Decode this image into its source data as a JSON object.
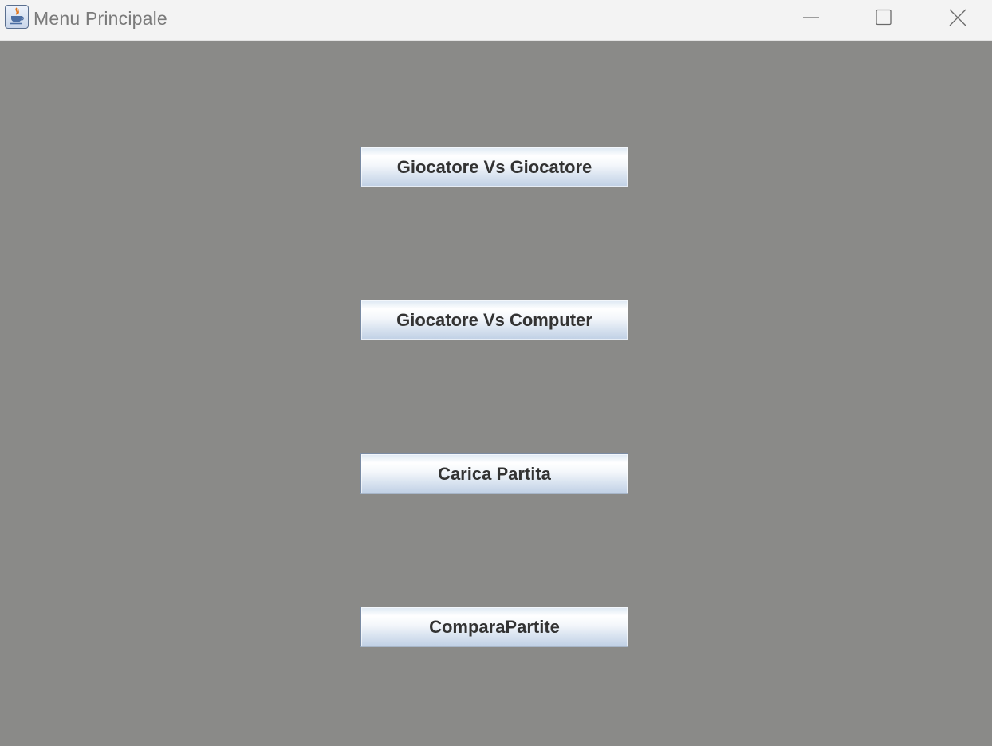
{
  "window": {
    "title": "Menu Principale",
    "app_icon": "java-coffee-cup-icon",
    "controls": {
      "minimize_icon": "minimize-icon",
      "maximize_icon": "maximize-icon",
      "close_icon": "close-icon"
    },
    "background_color": "#8a8a88"
  },
  "menu": {
    "buttons": [
      {
        "label": "Giocatore Vs Giocatore"
      },
      {
        "label": "Giocatore Vs Computer"
      },
      {
        "label": "Carica Partita"
      },
      {
        "label": "ComparaPartite"
      }
    ]
  }
}
